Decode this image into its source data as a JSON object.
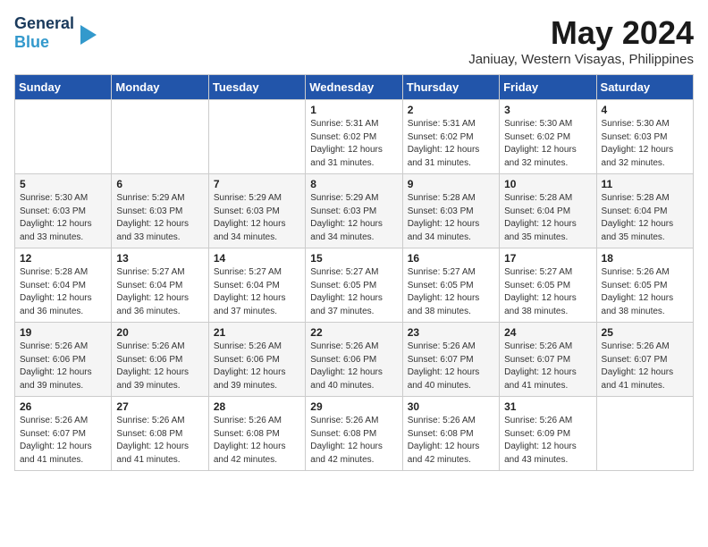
{
  "header": {
    "logo_line1": "General",
    "logo_line2": "Blue",
    "month_year": "May 2024",
    "location": "Janiuay, Western Visayas, Philippines"
  },
  "days_of_week": [
    "Sunday",
    "Monday",
    "Tuesday",
    "Wednesday",
    "Thursday",
    "Friday",
    "Saturday"
  ],
  "weeks": [
    [
      {
        "day": "",
        "info": ""
      },
      {
        "day": "",
        "info": ""
      },
      {
        "day": "",
        "info": ""
      },
      {
        "day": "1",
        "info": "Sunrise: 5:31 AM\nSunset: 6:02 PM\nDaylight: 12 hours\nand 31 minutes."
      },
      {
        "day": "2",
        "info": "Sunrise: 5:31 AM\nSunset: 6:02 PM\nDaylight: 12 hours\nand 31 minutes."
      },
      {
        "day": "3",
        "info": "Sunrise: 5:30 AM\nSunset: 6:02 PM\nDaylight: 12 hours\nand 32 minutes."
      },
      {
        "day": "4",
        "info": "Sunrise: 5:30 AM\nSunset: 6:03 PM\nDaylight: 12 hours\nand 32 minutes."
      }
    ],
    [
      {
        "day": "5",
        "info": "Sunrise: 5:30 AM\nSunset: 6:03 PM\nDaylight: 12 hours\nand 33 minutes."
      },
      {
        "day": "6",
        "info": "Sunrise: 5:29 AM\nSunset: 6:03 PM\nDaylight: 12 hours\nand 33 minutes."
      },
      {
        "day": "7",
        "info": "Sunrise: 5:29 AM\nSunset: 6:03 PM\nDaylight: 12 hours\nand 34 minutes."
      },
      {
        "day": "8",
        "info": "Sunrise: 5:29 AM\nSunset: 6:03 PM\nDaylight: 12 hours\nand 34 minutes."
      },
      {
        "day": "9",
        "info": "Sunrise: 5:28 AM\nSunset: 6:03 PM\nDaylight: 12 hours\nand 34 minutes."
      },
      {
        "day": "10",
        "info": "Sunrise: 5:28 AM\nSunset: 6:04 PM\nDaylight: 12 hours\nand 35 minutes."
      },
      {
        "day": "11",
        "info": "Sunrise: 5:28 AM\nSunset: 6:04 PM\nDaylight: 12 hours\nand 35 minutes."
      }
    ],
    [
      {
        "day": "12",
        "info": "Sunrise: 5:28 AM\nSunset: 6:04 PM\nDaylight: 12 hours\nand 36 minutes."
      },
      {
        "day": "13",
        "info": "Sunrise: 5:27 AM\nSunset: 6:04 PM\nDaylight: 12 hours\nand 36 minutes."
      },
      {
        "day": "14",
        "info": "Sunrise: 5:27 AM\nSunset: 6:04 PM\nDaylight: 12 hours\nand 37 minutes."
      },
      {
        "day": "15",
        "info": "Sunrise: 5:27 AM\nSunset: 6:05 PM\nDaylight: 12 hours\nand 37 minutes."
      },
      {
        "day": "16",
        "info": "Sunrise: 5:27 AM\nSunset: 6:05 PM\nDaylight: 12 hours\nand 38 minutes."
      },
      {
        "day": "17",
        "info": "Sunrise: 5:27 AM\nSunset: 6:05 PM\nDaylight: 12 hours\nand 38 minutes."
      },
      {
        "day": "18",
        "info": "Sunrise: 5:26 AM\nSunset: 6:05 PM\nDaylight: 12 hours\nand 38 minutes."
      }
    ],
    [
      {
        "day": "19",
        "info": "Sunrise: 5:26 AM\nSunset: 6:06 PM\nDaylight: 12 hours\nand 39 minutes."
      },
      {
        "day": "20",
        "info": "Sunrise: 5:26 AM\nSunset: 6:06 PM\nDaylight: 12 hours\nand 39 minutes."
      },
      {
        "day": "21",
        "info": "Sunrise: 5:26 AM\nSunset: 6:06 PM\nDaylight: 12 hours\nand 39 minutes."
      },
      {
        "day": "22",
        "info": "Sunrise: 5:26 AM\nSunset: 6:06 PM\nDaylight: 12 hours\nand 40 minutes."
      },
      {
        "day": "23",
        "info": "Sunrise: 5:26 AM\nSunset: 6:07 PM\nDaylight: 12 hours\nand 40 minutes."
      },
      {
        "day": "24",
        "info": "Sunrise: 5:26 AM\nSunset: 6:07 PM\nDaylight: 12 hours\nand 41 minutes."
      },
      {
        "day": "25",
        "info": "Sunrise: 5:26 AM\nSunset: 6:07 PM\nDaylight: 12 hours\nand 41 minutes."
      }
    ],
    [
      {
        "day": "26",
        "info": "Sunrise: 5:26 AM\nSunset: 6:07 PM\nDaylight: 12 hours\nand 41 minutes."
      },
      {
        "day": "27",
        "info": "Sunrise: 5:26 AM\nSunset: 6:08 PM\nDaylight: 12 hours\nand 41 minutes."
      },
      {
        "day": "28",
        "info": "Sunrise: 5:26 AM\nSunset: 6:08 PM\nDaylight: 12 hours\nand 42 minutes."
      },
      {
        "day": "29",
        "info": "Sunrise: 5:26 AM\nSunset: 6:08 PM\nDaylight: 12 hours\nand 42 minutes."
      },
      {
        "day": "30",
        "info": "Sunrise: 5:26 AM\nSunset: 6:08 PM\nDaylight: 12 hours\nand 42 minutes."
      },
      {
        "day": "31",
        "info": "Sunrise: 5:26 AM\nSunset: 6:09 PM\nDaylight: 12 hours\nand 43 minutes."
      },
      {
        "day": "",
        "info": ""
      }
    ]
  ]
}
